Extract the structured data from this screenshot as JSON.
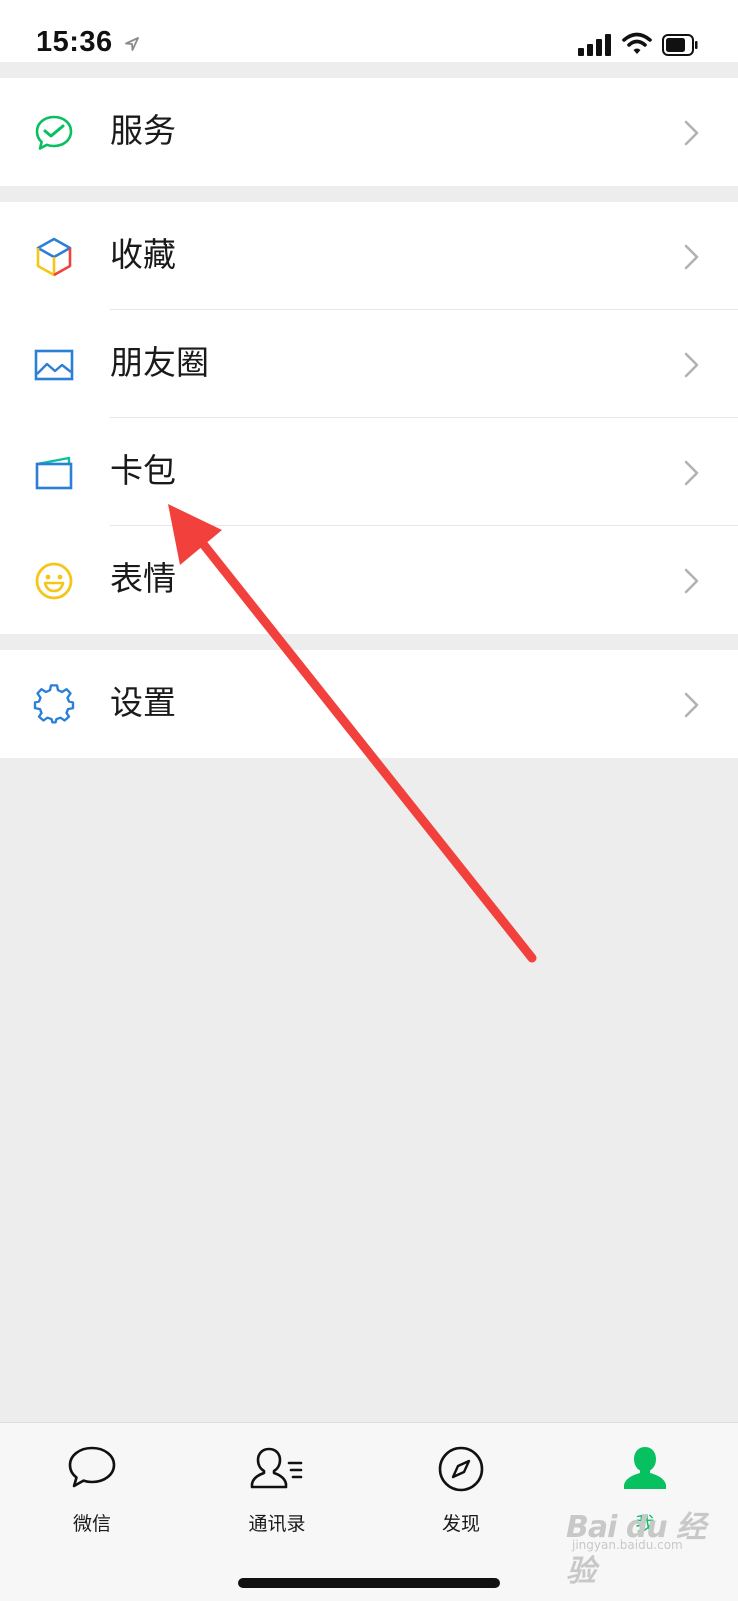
{
  "status_bar": {
    "time": "15:36"
  },
  "groups": {
    "services": {
      "label": "服务"
    },
    "favorites": {
      "label": "收藏"
    },
    "moments": {
      "label": "朋友圈"
    },
    "cards": {
      "label": "卡包"
    },
    "stickers": {
      "label": "表情"
    },
    "settings": {
      "label": "设置"
    }
  },
  "tabbar": {
    "chats": "微信",
    "contacts": "通讯录",
    "discover": "发现",
    "me": "我"
  },
  "watermark": {
    "main": "Bai du 经验",
    "sub": "jingyan.baidu.com"
  },
  "colors": {
    "accent_green": "#07c160",
    "annotation_red": "#f2413c",
    "icon_blue": "#2b7fd6",
    "icon_yellow": "#f5c518"
  },
  "icons": {
    "services": "wechat-pay-check-icon",
    "favorites": "cube-icon",
    "moments": "landscape-image-icon",
    "cards": "card-wallet-icon",
    "stickers": "smiley-icon",
    "settings": "gear-icon"
  }
}
